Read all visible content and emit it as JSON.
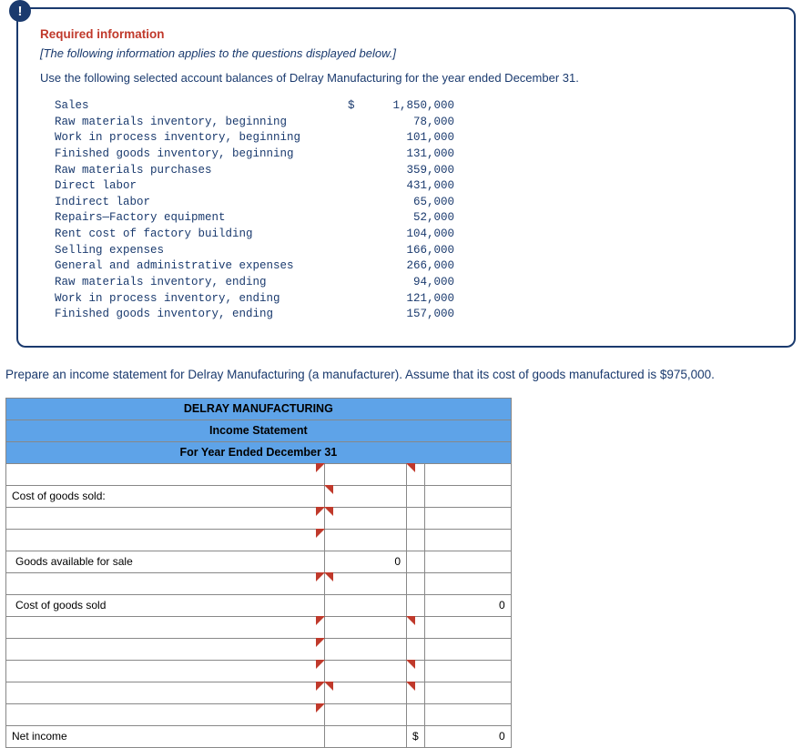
{
  "info": {
    "heading": "Required information",
    "subnote": "[The following information applies to the questions displayed below.]",
    "instruction": "Use the following selected account balances of Delray Manufacturing for the year ended December 31."
  },
  "accounts": [
    {
      "label": "Sales",
      "sym": "$ ",
      "value": "1,850,000"
    },
    {
      "label": "Raw materials inventory, beginning",
      "sym": "",
      "value": "78,000"
    },
    {
      "label": "Work in process inventory, beginning",
      "sym": "",
      "value": "101,000"
    },
    {
      "label": "Finished goods inventory, beginning",
      "sym": "",
      "value": "131,000"
    },
    {
      "label": "Raw materials purchases",
      "sym": "",
      "value": "359,000"
    },
    {
      "label": "Direct labor",
      "sym": "",
      "value": "431,000"
    },
    {
      "label": "Indirect labor",
      "sym": "",
      "value": "65,000"
    },
    {
      "label": "Repairs—Factory equipment",
      "sym": "",
      "value": "52,000"
    },
    {
      "label": "Rent cost of factory building",
      "sym": "",
      "value": "104,000"
    },
    {
      "label": "Selling expenses",
      "sym": "",
      "value": "166,000"
    },
    {
      "label": "General and administrative expenses",
      "sym": "",
      "value": "266,000"
    },
    {
      "label": "Raw materials inventory, ending",
      "sym": "",
      "value": "94,000"
    },
    {
      "label": "Work in process inventory, ending",
      "sym": "",
      "value": "121,000"
    },
    {
      "label": "Finished goods inventory, ending",
      "sym": "",
      "value": "157,000"
    }
  ],
  "prepare": "Prepare an income statement for Delray Manufacturing (a manufacturer). Assume that its cost of goods manufactured is $975,000.",
  "stmt": {
    "header1": "DELRAY MANUFACTURING",
    "header2": "Income Statement",
    "header3": "For Year Ended December 31",
    "cogs_label": "Cost of goods sold:",
    "goods_avail": "Goods available for sale",
    "goods_avail_val": "0",
    "cogs_line": "Cost of goods sold",
    "cogs_val": "0",
    "net_income": "Net income",
    "net_sym": "$",
    "net_val": "0"
  }
}
